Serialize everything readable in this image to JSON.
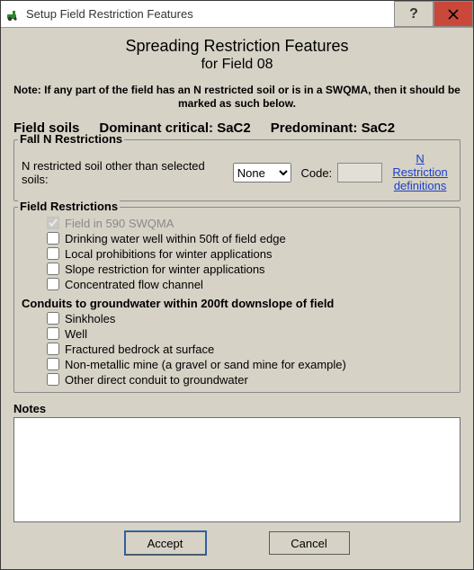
{
  "window": {
    "title": "Setup Field Restriction Features"
  },
  "header": {
    "title": "Spreading Restriction Features",
    "subtitle": "for Field 08",
    "note": "Note: If any part of the field has an N restricted soil or is in a SWQMA, then it should be marked as such below."
  },
  "soil": {
    "label_field_soils": "Field soils",
    "label_dominant": "Dominant critical: SaC2",
    "label_predominant": "Predominant: SaC2"
  },
  "falln": {
    "legend": "Fall N Restrictions",
    "label": "N restricted soil other than selected soils:",
    "select_value": "None",
    "code_label": "Code:",
    "code_value": "",
    "link_line1": "N Restriction",
    "link_line2": "definitions"
  },
  "fieldres": {
    "legend": "Field Restrictions",
    "items": [
      {
        "label": "Field in 590 SWQMA",
        "checked": true,
        "disabled": true
      },
      {
        "label": "Drinking water well within 50ft of field edge",
        "checked": false,
        "disabled": false
      },
      {
        "label": "Local prohibitions for winter applications",
        "checked": false,
        "disabled": false
      },
      {
        "label": "Slope restriction for winter applications",
        "checked": false,
        "disabled": false
      },
      {
        "label": "Concentrated flow channel",
        "checked": false,
        "disabled": false
      }
    ],
    "sub_legend": "Conduits to groundwater within 200ft downslope of field",
    "sub_items": [
      {
        "label": "Sinkholes"
      },
      {
        "label": "Well"
      },
      {
        "label": "Fractured bedrock at surface"
      },
      {
        "label": "Non-metallic mine (a gravel or sand mine for example)"
      },
      {
        "label": "Other direct conduit to groundwater"
      }
    ]
  },
  "notes": {
    "label": "Notes",
    "value": ""
  },
  "buttons": {
    "accept": "Accept",
    "cancel": "Cancel"
  }
}
